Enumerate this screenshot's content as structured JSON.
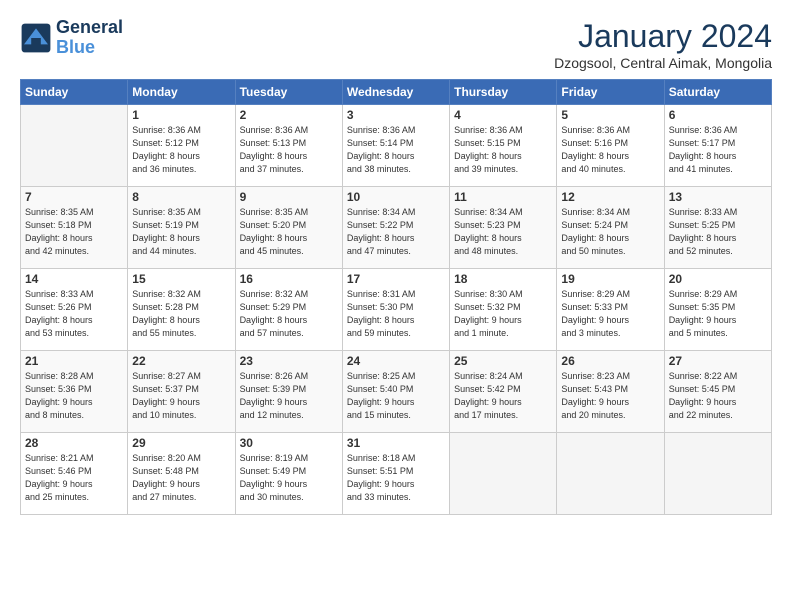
{
  "logo": {
    "line1": "General",
    "line2": "Blue"
  },
  "title": "January 2024",
  "location": "Dzogsool, Central Aimak, Mongolia",
  "days_header": [
    "Sunday",
    "Monday",
    "Tuesday",
    "Wednesday",
    "Thursday",
    "Friday",
    "Saturday"
  ],
  "weeks": [
    [
      {
        "num": "",
        "info": ""
      },
      {
        "num": "1",
        "info": "Sunrise: 8:36 AM\nSunset: 5:12 PM\nDaylight: 8 hours\nand 36 minutes."
      },
      {
        "num": "2",
        "info": "Sunrise: 8:36 AM\nSunset: 5:13 PM\nDaylight: 8 hours\nand 37 minutes."
      },
      {
        "num": "3",
        "info": "Sunrise: 8:36 AM\nSunset: 5:14 PM\nDaylight: 8 hours\nand 38 minutes."
      },
      {
        "num": "4",
        "info": "Sunrise: 8:36 AM\nSunset: 5:15 PM\nDaylight: 8 hours\nand 39 minutes."
      },
      {
        "num": "5",
        "info": "Sunrise: 8:36 AM\nSunset: 5:16 PM\nDaylight: 8 hours\nand 40 minutes."
      },
      {
        "num": "6",
        "info": "Sunrise: 8:36 AM\nSunset: 5:17 PM\nDaylight: 8 hours\nand 41 minutes."
      }
    ],
    [
      {
        "num": "7",
        "info": "Sunrise: 8:35 AM\nSunset: 5:18 PM\nDaylight: 8 hours\nand 42 minutes."
      },
      {
        "num": "8",
        "info": "Sunrise: 8:35 AM\nSunset: 5:19 PM\nDaylight: 8 hours\nand 44 minutes."
      },
      {
        "num": "9",
        "info": "Sunrise: 8:35 AM\nSunset: 5:20 PM\nDaylight: 8 hours\nand 45 minutes."
      },
      {
        "num": "10",
        "info": "Sunrise: 8:34 AM\nSunset: 5:22 PM\nDaylight: 8 hours\nand 47 minutes."
      },
      {
        "num": "11",
        "info": "Sunrise: 8:34 AM\nSunset: 5:23 PM\nDaylight: 8 hours\nand 48 minutes."
      },
      {
        "num": "12",
        "info": "Sunrise: 8:34 AM\nSunset: 5:24 PM\nDaylight: 8 hours\nand 50 minutes."
      },
      {
        "num": "13",
        "info": "Sunrise: 8:33 AM\nSunset: 5:25 PM\nDaylight: 8 hours\nand 52 minutes."
      }
    ],
    [
      {
        "num": "14",
        "info": "Sunrise: 8:33 AM\nSunset: 5:26 PM\nDaylight: 8 hours\nand 53 minutes."
      },
      {
        "num": "15",
        "info": "Sunrise: 8:32 AM\nSunset: 5:28 PM\nDaylight: 8 hours\nand 55 minutes."
      },
      {
        "num": "16",
        "info": "Sunrise: 8:32 AM\nSunset: 5:29 PM\nDaylight: 8 hours\nand 57 minutes."
      },
      {
        "num": "17",
        "info": "Sunrise: 8:31 AM\nSunset: 5:30 PM\nDaylight: 8 hours\nand 59 minutes."
      },
      {
        "num": "18",
        "info": "Sunrise: 8:30 AM\nSunset: 5:32 PM\nDaylight: 9 hours\nand 1 minute."
      },
      {
        "num": "19",
        "info": "Sunrise: 8:29 AM\nSunset: 5:33 PM\nDaylight: 9 hours\nand 3 minutes."
      },
      {
        "num": "20",
        "info": "Sunrise: 8:29 AM\nSunset: 5:35 PM\nDaylight: 9 hours\nand 5 minutes."
      }
    ],
    [
      {
        "num": "21",
        "info": "Sunrise: 8:28 AM\nSunset: 5:36 PM\nDaylight: 9 hours\nand 8 minutes."
      },
      {
        "num": "22",
        "info": "Sunrise: 8:27 AM\nSunset: 5:37 PM\nDaylight: 9 hours\nand 10 minutes."
      },
      {
        "num": "23",
        "info": "Sunrise: 8:26 AM\nSunset: 5:39 PM\nDaylight: 9 hours\nand 12 minutes."
      },
      {
        "num": "24",
        "info": "Sunrise: 8:25 AM\nSunset: 5:40 PM\nDaylight: 9 hours\nand 15 minutes."
      },
      {
        "num": "25",
        "info": "Sunrise: 8:24 AM\nSunset: 5:42 PM\nDaylight: 9 hours\nand 17 minutes."
      },
      {
        "num": "26",
        "info": "Sunrise: 8:23 AM\nSunset: 5:43 PM\nDaylight: 9 hours\nand 20 minutes."
      },
      {
        "num": "27",
        "info": "Sunrise: 8:22 AM\nSunset: 5:45 PM\nDaylight: 9 hours\nand 22 minutes."
      }
    ],
    [
      {
        "num": "28",
        "info": "Sunrise: 8:21 AM\nSunset: 5:46 PM\nDaylight: 9 hours\nand 25 minutes."
      },
      {
        "num": "29",
        "info": "Sunrise: 8:20 AM\nSunset: 5:48 PM\nDaylight: 9 hours\nand 27 minutes."
      },
      {
        "num": "30",
        "info": "Sunrise: 8:19 AM\nSunset: 5:49 PM\nDaylight: 9 hours\nand 30 minutes."
      },
      {
        "num": "31",
        "info": "Sunrise: 8:18 AM\nSunset: 5:51 PM\nDaylight: 9 hours\nand 33 minutes."
      },
      {
        "num": "",
        "info": ""
      },
      {
        "num": "",
        "info": ""
      },
      {
        "num": "",
        "info": ""
      }
    ]
  ]
}
